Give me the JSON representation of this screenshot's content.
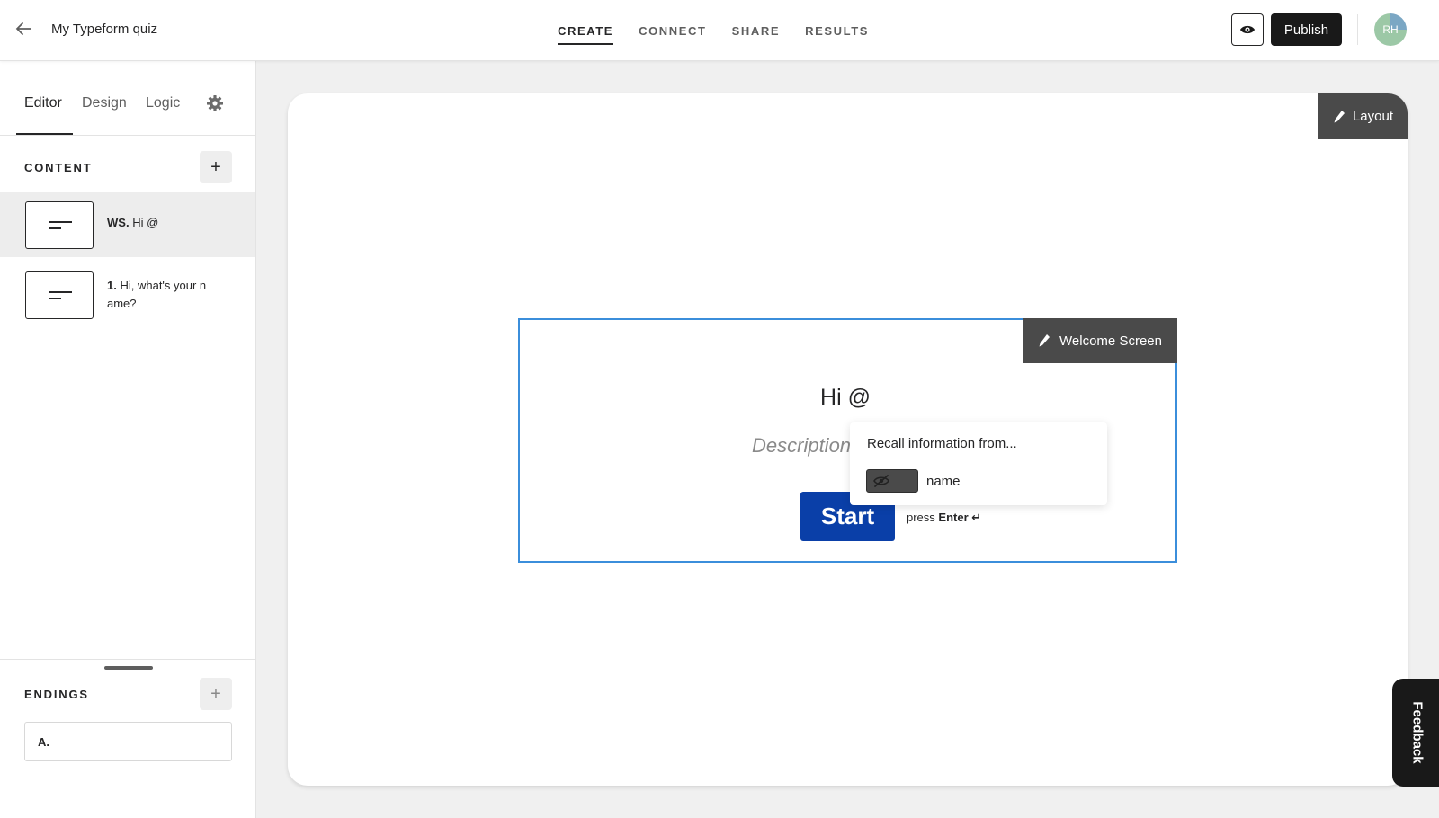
{
  "header": {
    "form_title": "My Typeform quiz",
    "tabs": [
      {
        "label": "CREATE",
        "active": true
      },
      {
        "label": "CONNECT",
        "active": false
      },
      {
        "label": "SHARE",
        "active": false
      },
      {
        "label": "RESULTS",
        "active": false
      }
    ],
    "publish_label": "Publish",
    "avatar_initials": "RH"
  },
  "sidebar": {
    "tabs": [
      {
        "label": "Editor",
        "active": true
      },
      {
        "label": "Design",
        "active": false
      },
      {
        "label": "Logic",
        "active": false
      }
    ],
    "content_label": "CONTENT",
    "questions": [
      {
        "ref": "WS.",
        "text": "Hi @",
        "selected": true
      },
      {
        "ref": "1.",
        "text": "Hi, what's your n ame?",
        "selected": false
      }
    ],
    "endings_label": "ENDINGS",
    "endings": [
      {
        "ref": "A."
      }
    ]
  },
  "canvas": {
    "layout_label": "Layout",
    "block_label": "Welcome Screen",
    "title": "Hi @",
    "description_placeholder": "Description",
    "start_label": "Start",
    "press_label": "press",
    "enter_label": "Enter ↵"
  },
  "recall_popup": {
    "title": "Recall information from...",
    "items": [
      {
        "name": "name"
      }
    ]
  },
  "feedback_label": "Feedback",
  "colors": {
    "accent": "#3b8edb",
    "start_button": "#0a3fa8",
    "dark": "#191919"
  },
  "icons": [
    "back-arrow-icon",
    "eye-icon",
    "gear-icon",
    "plus-icon",
    "pencil-icon",
    "eye-off-icon"
  ]
}
